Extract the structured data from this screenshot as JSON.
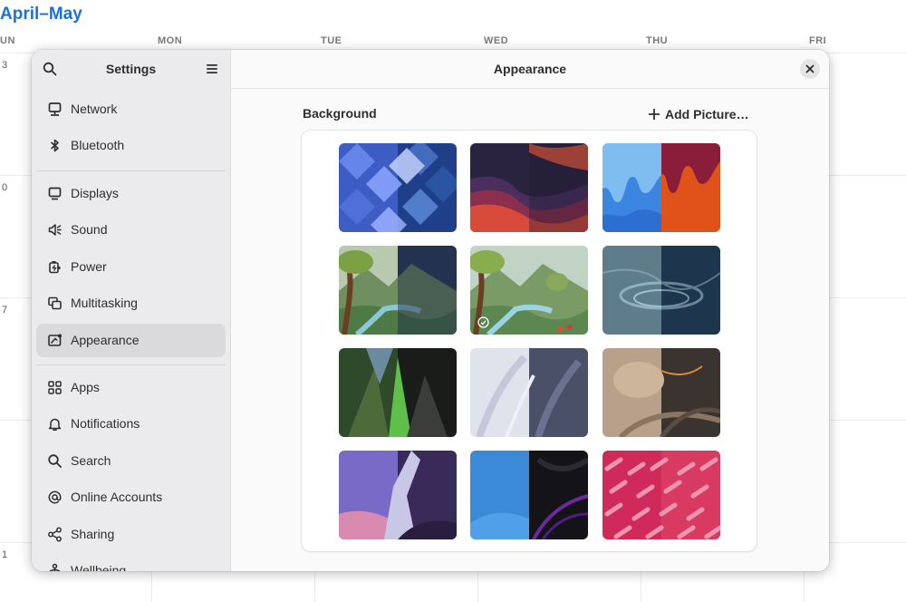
{
  "calendar": {
    "title": "April–May",
    "days": [
      "UN",
      "MON",
      "TUE",
      "WED",
      "THU",
      "FRI"
    ],
    "dates": [
      "3",
      "0",
      "7",
      "1"
    ]
  },
  "sidebar": {
    "title": "Settings",
    "items": [
      {
        "label": "Network",
        "icon": "network-icon"
      },
      {
        "label": "Bluetooth",
        "icon": "bluetooth-icon"
      },
      {
        "label": "Displays",
        "icon": "display-icon"
      },
      {
        "label": "Sound",
        "icon": "sound-icon"
      },
      {
        "label": "Power",
        "icon": "power-icon"
      },
      {
        "label": "Multitasking",
        "icon": "multitasking-icon"
      },
      {
        "label": "Appearance",
        "icon": "appearance-icon",
        "active": true
      },
      {
        "label": "Apps",
        "icon": "apps-icon"
      },
      {
        "label": "Notifications",
        "icon": "bell-icon"
      },
      {
        "label": "Search",
        "icon": "search-icon"
      },
      {
        "label": "Online Accounts",
        "icon": "at-icon"
      },
      {
        "label": "Sharing",
        "icon": "share-icon"
      },
      {
        "label": "Wellbeing",
        "icon": "wellbeing-icon"
      }
    ]
  },
  "main": {
    "title": "Appearance",
    "section_label": "Background",
    "add_label": "Add Picture…",
    "selected_wallpaper_index": 4
  },
  "colors": {
    "accent": "#1c71d8",
    "sidebar_bg": "#ebebed",
    "active_item": "#dadadc"
  }
}
